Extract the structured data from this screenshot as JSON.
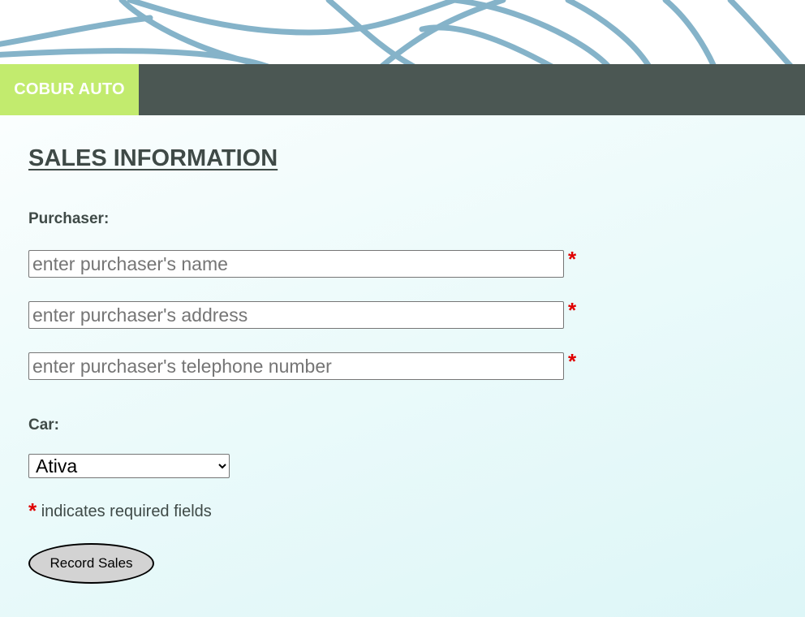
{
  "header": {
    "brand": "COBUR AUTO"
  },
  "form": {
    "title": "SALES INFORMATION",
    "purchaser_label": "Purchaser:",
    "name_placeholder": "enter purchaser's name",
    "address_placeholder": "enter purchaser's address",
    "phone_placeholder": "enter purchaser's telephone number",
    "required_marker": "*",
    "car_label": "Car:",
    "car_selected": "Ativa",
    "required_note": "indicates required fields",
    "submit_label": "Record Sales"
  },
  "colors": {
    "nav_bar": "#4b5753",
    "brand_bg": "#c2eb6e",
    "banner_lines": "#85b3c9",
    "required": "#e00000",
    "heading_text": "#3f4a47"
  }
}
